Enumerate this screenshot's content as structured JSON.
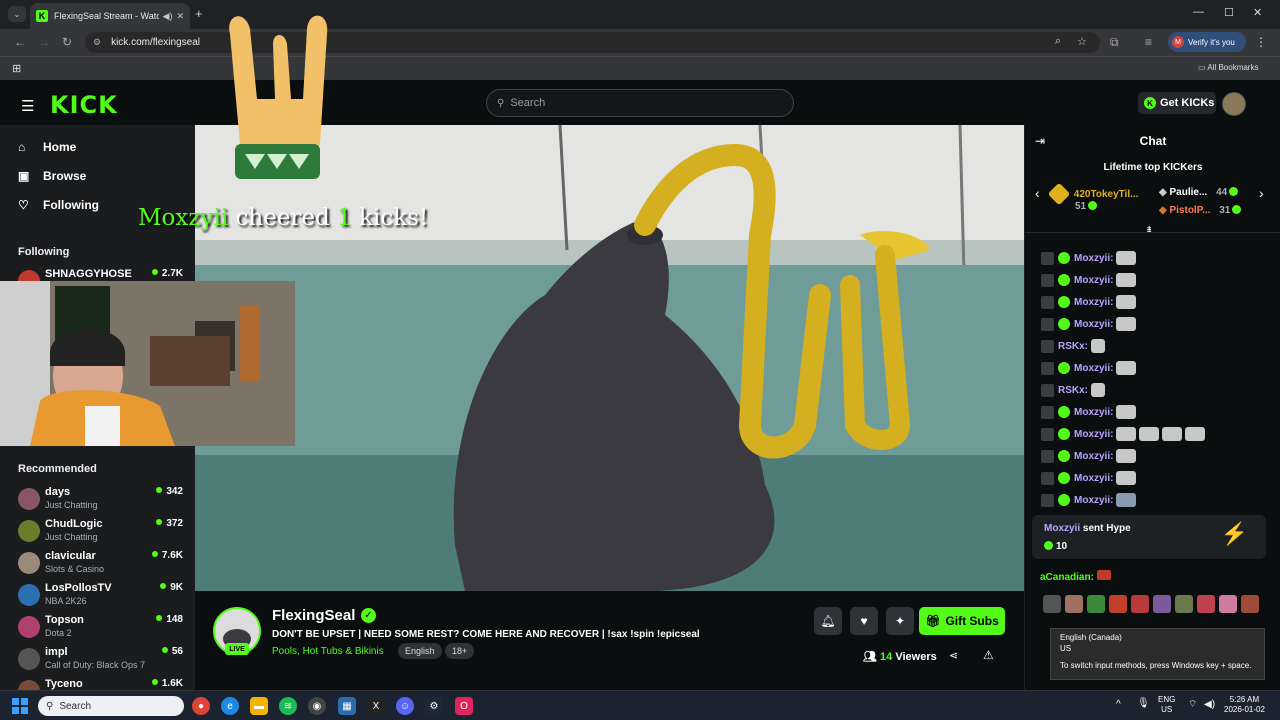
{
  "browser": {
    "tab_title": "FlexingSeal Stream - Watch",
    "url": "kick.com/flexingseal",
    "verify_label": "Verify it's you",
    "verify_initial": "M",
    "bookmarks_label": "All Bookmarks"
  },
  "header": {
    "logo": "KICK",
    "search_placeholder": "Search",
    "get_kicks_label": "Get KICKs"
  },
  "sidebar": {
    "nav": [
      {
        "label": "Home",
        "icon": "home-icon"
      },
      {
        "label": "Browse",
        "icon": "browse-icon"
      },
      {
        "label": "Following",
        "icon": "heart-icon"
      }
    ],
    "following_heading": "Following",
    "following": [
      {
        "name": "SHNAGGYHOSE",
        "viewers": "2.7K"
      }
    ],
    "recommended_heading": "Recommended",
    "recommended": [
      {
        "name": "days",
        "category": "Just Chatting",
        "viewers": "342"
      },
      {
        "name": "ChudLogic",
        "category": "Just Chatting",
        "viewers": "372"
      },
      {
        "name": "clavicular",
        "category": "Slots & Casino",
        "viewers": "7.6K"
      },
      {
        "name": "LosPollosTV",
        "category": "NBA 2K26",
        "viewers": "9K"
      },
      {
        "name": "Topson",
        "category": "Dota 2",
        "viewers": "148"
      },
      {
        "name": "impl",
        "category": "Call of Duty: Black Ops 7",
        "viewers": "56"
      },
      {
        "name": "Tyceno",
        "category": "",
        "viewers": "1.6K"
      }
    ]
  },
  "overlay": {
    "cheer_user": "Moxzyii",
    "cheer_mid": " cheered ",
    "cheer_amount": "1",
    "cheer_end": " kicks!"
  },
  "stream": {
    "channel": "FlexingSeal",
    "live_badge": "LIVE",
    "title": "DON'T BE UPSET | NEED SOME REST? COME HERE AND RECOVER | !sax !spin !epicseal",
    "category": "Pools, Hot Tubs & Bikinis",
    "tags": [
      "English",
      "18+"
    ],
    "gift_subs_label": "Gift Subs",
    "viewers_count": "14",
    "viewers_label": "Viewers"
  },
  "chat": {
    "title": "Chat",
    "lifetime_heading": "Lifetime top KICKers",
    "top_kickers": [
      {
        "name": "420TokeyTil...",
        "amount": "51"
      },
      {
        "name": "Paulie...",
        "amount": "44"
      },
      {
        "name": "PistolP...",
        "amount": "31"
      }
    ],
    "messages": [
      {
        "user": "Moxzyii:",
        "emotes": 1
      },
      {
        "user": "Moxzyii:",
        "emotes": 1
      },
      {
        "user": "Moxzyii:",
        "emotes": 1
      },
      {
        "user": "Moxzyii:",
        "emotes": 1
      },
      {
        "user": "RSKx:",
        "emotes": 1
      },
      {
        "user": "Moxzyii:",
        "emotes": 1
      },
      {
        "user": "RSKx:",
        "emotes": 1
      },
      {
        "user": "Moxzyii:",
        "emotes": 1
      },
      {
        "user": "Moxzyii:",
        "emotes": 4
      },
      {
        "user": "Moxzyii:",
        "emotes": 1
      },
      {
        "user": "Moxzyii:",
        "emotes": 1
      },
      {
        "user": "Moxzyii:",
        "emotes": 1
      }
    ],
    "hype_user": "Moxzyii",
    "hype_text": " sent ",
    "hype_item": "Hype",
    "hype_amount": "10",
    "last_user": "aCanadian:"
  },
  "tooltip": {
    "line1": "English (Canada)",
    "line2": "US",
    "line3": "To switch input methods, press Windows key + space."
  },
  "taskbar": {
    "search_label": "Search",
    "lang": "ENG",
    "region": "US",
    "time": "5:26 AM",
    "date": "2026-01-02"
  },
  "colors": {
    "accent": "#53fc18",
    "bg": "#0b0e0f",
    "sidebar": "#1a1c1e"
  }
}
